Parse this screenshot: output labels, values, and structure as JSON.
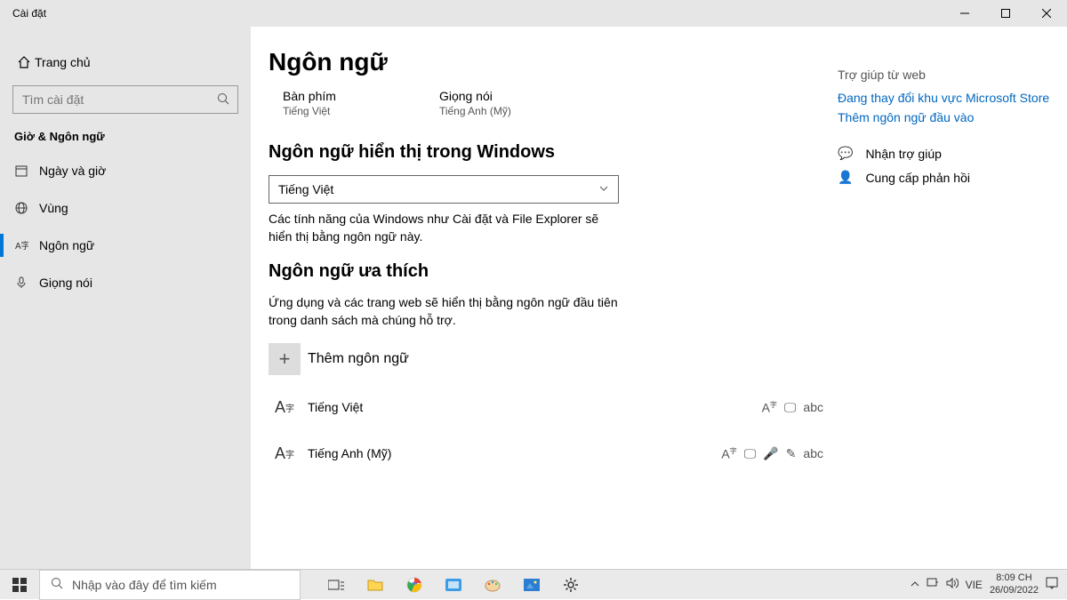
{
  "window": {
    "title": "Cài đặt"
  },
  "sidebar": {
    "home": "Trang chủ",
    "search_placeholder": "Tìm cài đặt",
    "section": "Giờ & Ngôn ngữ",
    "items": [
      {
        "label": "Ngày và giờ"
      },
      {
        "label": "Vùng"
      },
      {
        "label": "Ngôn ngữ"
      },
      {
        "label": "Giọng nói"
      }
    ]
  },
  "page": {
    "title": "Ngôn ngữ",
    "keyboard_label": "Bàn phím",
    "keyboard_value": "Tiếng Việt",
    "voice_label": "Giọng nói",
    "voice_value": "Tiếng Anh (Mỹ)",
    "display_heading": "Ngôn ngữ hiển thị trong Windows",
    "display_selected": "Tiếng Việt",
    "display_desc": "Các tính năng của Windows như Cài đặt và File Explorer sẽ hiển thị bằng ngôn ngữ này.",
    "preferred_heading": "Ngôn ngữ ưa thích",
    "preferred_desc": "Ứng dụng và các trang web sẽ hiển thị bằng ngôn ngữ đầu tiên trong danh sách mà chúng hỗ trợ.",
    "add_language": "Thêm ngôn ngữ",
    "languages": [
      {
        "name": "Tiếng Việt"
      },
      {
        "name": "Tiếng Anh (Mỹ)"
      }
    ]
  },
  "help": {
    "header": "Trợ giúp từ web",
    "links": [
      "Đang thay đổi khu vực Microsoft Store",
      "Thêm ngôn ngữ đầu vào"
    ],
    "get_help": "Nhận trợ giúp",
    "feedback": "Cung cấp phản hồi"
  },
  "taskbar": {
    "search_placeholder": "Nhập vào đây để tìm kiếm",
    "ime": "VIE",
    "time": "8:09 CH",
    "date": "26/09/2022"
  }
}
